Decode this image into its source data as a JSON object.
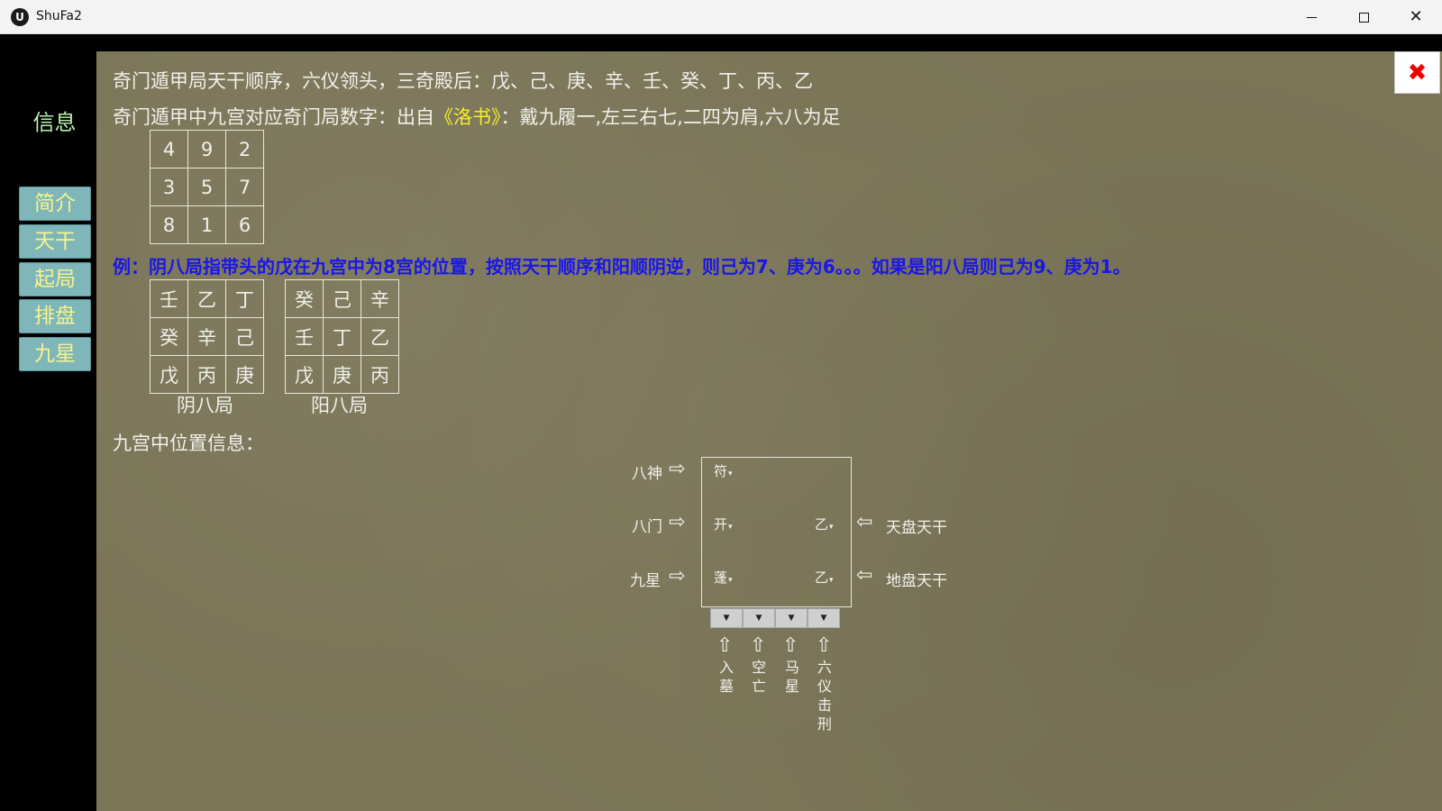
{
  "window": {
    "title": "ShuFa2",
    "icon": "U"
  },
  "sidebar": {
    "title": "信息",
    "items": [
      {
        "label": "简介"
      },
      {
        "label": "天干"
      },
      {
        "label": "起局"
      },
      {
        "label": "排盘"
      },
      {
        "label": "九星"
      }
    ]
  },
  "main": {
    "line1": "奇门遁甲局天干顺序，六仪领头，三奇殿后：戊、己、庚、辛、壬、癸、丁、丙、乙",
    "line2_a": "奇门遁甲中九宫对应奇门局数字：出自",
    "line2_book": "《洛书》",
    "line2_b": "：戴九履一,左三右七,二四为肩,六八为足",
    "luoshu": [
      [
        "4",
        "9",
        "2"
      ],
      [
        "3",
        "5",
        "7"
      ],
      [
        "8",
        "1",
        "6"
      ]
    ],
    "example": "例：阴八局指带头的戊在九宫中为8宫的位置，按照天干顺序和阳顺阴逆，则己为7、庚为6。。。如果是阳八局则己为9、庚为1。",
    "yin_grid": [
      [
        "壬",
        "乙",
        "丁"
      ],
      [
        "癸",
        "辛",
        "己"
      ],
      [
        "戊",
        "丙",
        "庚"
      ]
    ],
    "yin_caption": "阴八局",
    "yang_grid": [
      [
        "癸",
        "己",
        "辛"
      ],
      [
        "壬",
        "丁",
        "乙"
      ],
      [
        "戊",
        "庚",
        "丙"
      ]
    ],
    "yang_caption": "阳八局",
    "position_title": "九宫中位置信息："
  },
  "diagram": {
    "label_bashen": "八神",
    "label_bamen": "八门",
    "label_jiuxing": "九星",
    "label_tianpan": "天盘天干",
    "label_dipan": "地盘天干",
    "sel_shen": "符",
    "sel_men": "开",
    "sel_xing": "蓬",
    "sel_tian": "乙",
    "sel_di": "乙",
    "bottom": [
      {
        "chars": [
          "入",
          "墓"
        ]
      },
      {
        "chars": [
          "空",
          "亡"
        ]
      },
      {
        "chars": [
          "马",
          "星"
        ]
      },
      {
        "chars": [
          "六",
          "仪",
          "击",
          "刑"
        ]
      }
    ]
  },
  "colors": {
    "accent_yellow": "#f8ee2a",
    "example_blue": "#1a16e8",
    "side_button": "#7fb6ba",
    "sidebar_title": "#b8f3ad"
  }
}
